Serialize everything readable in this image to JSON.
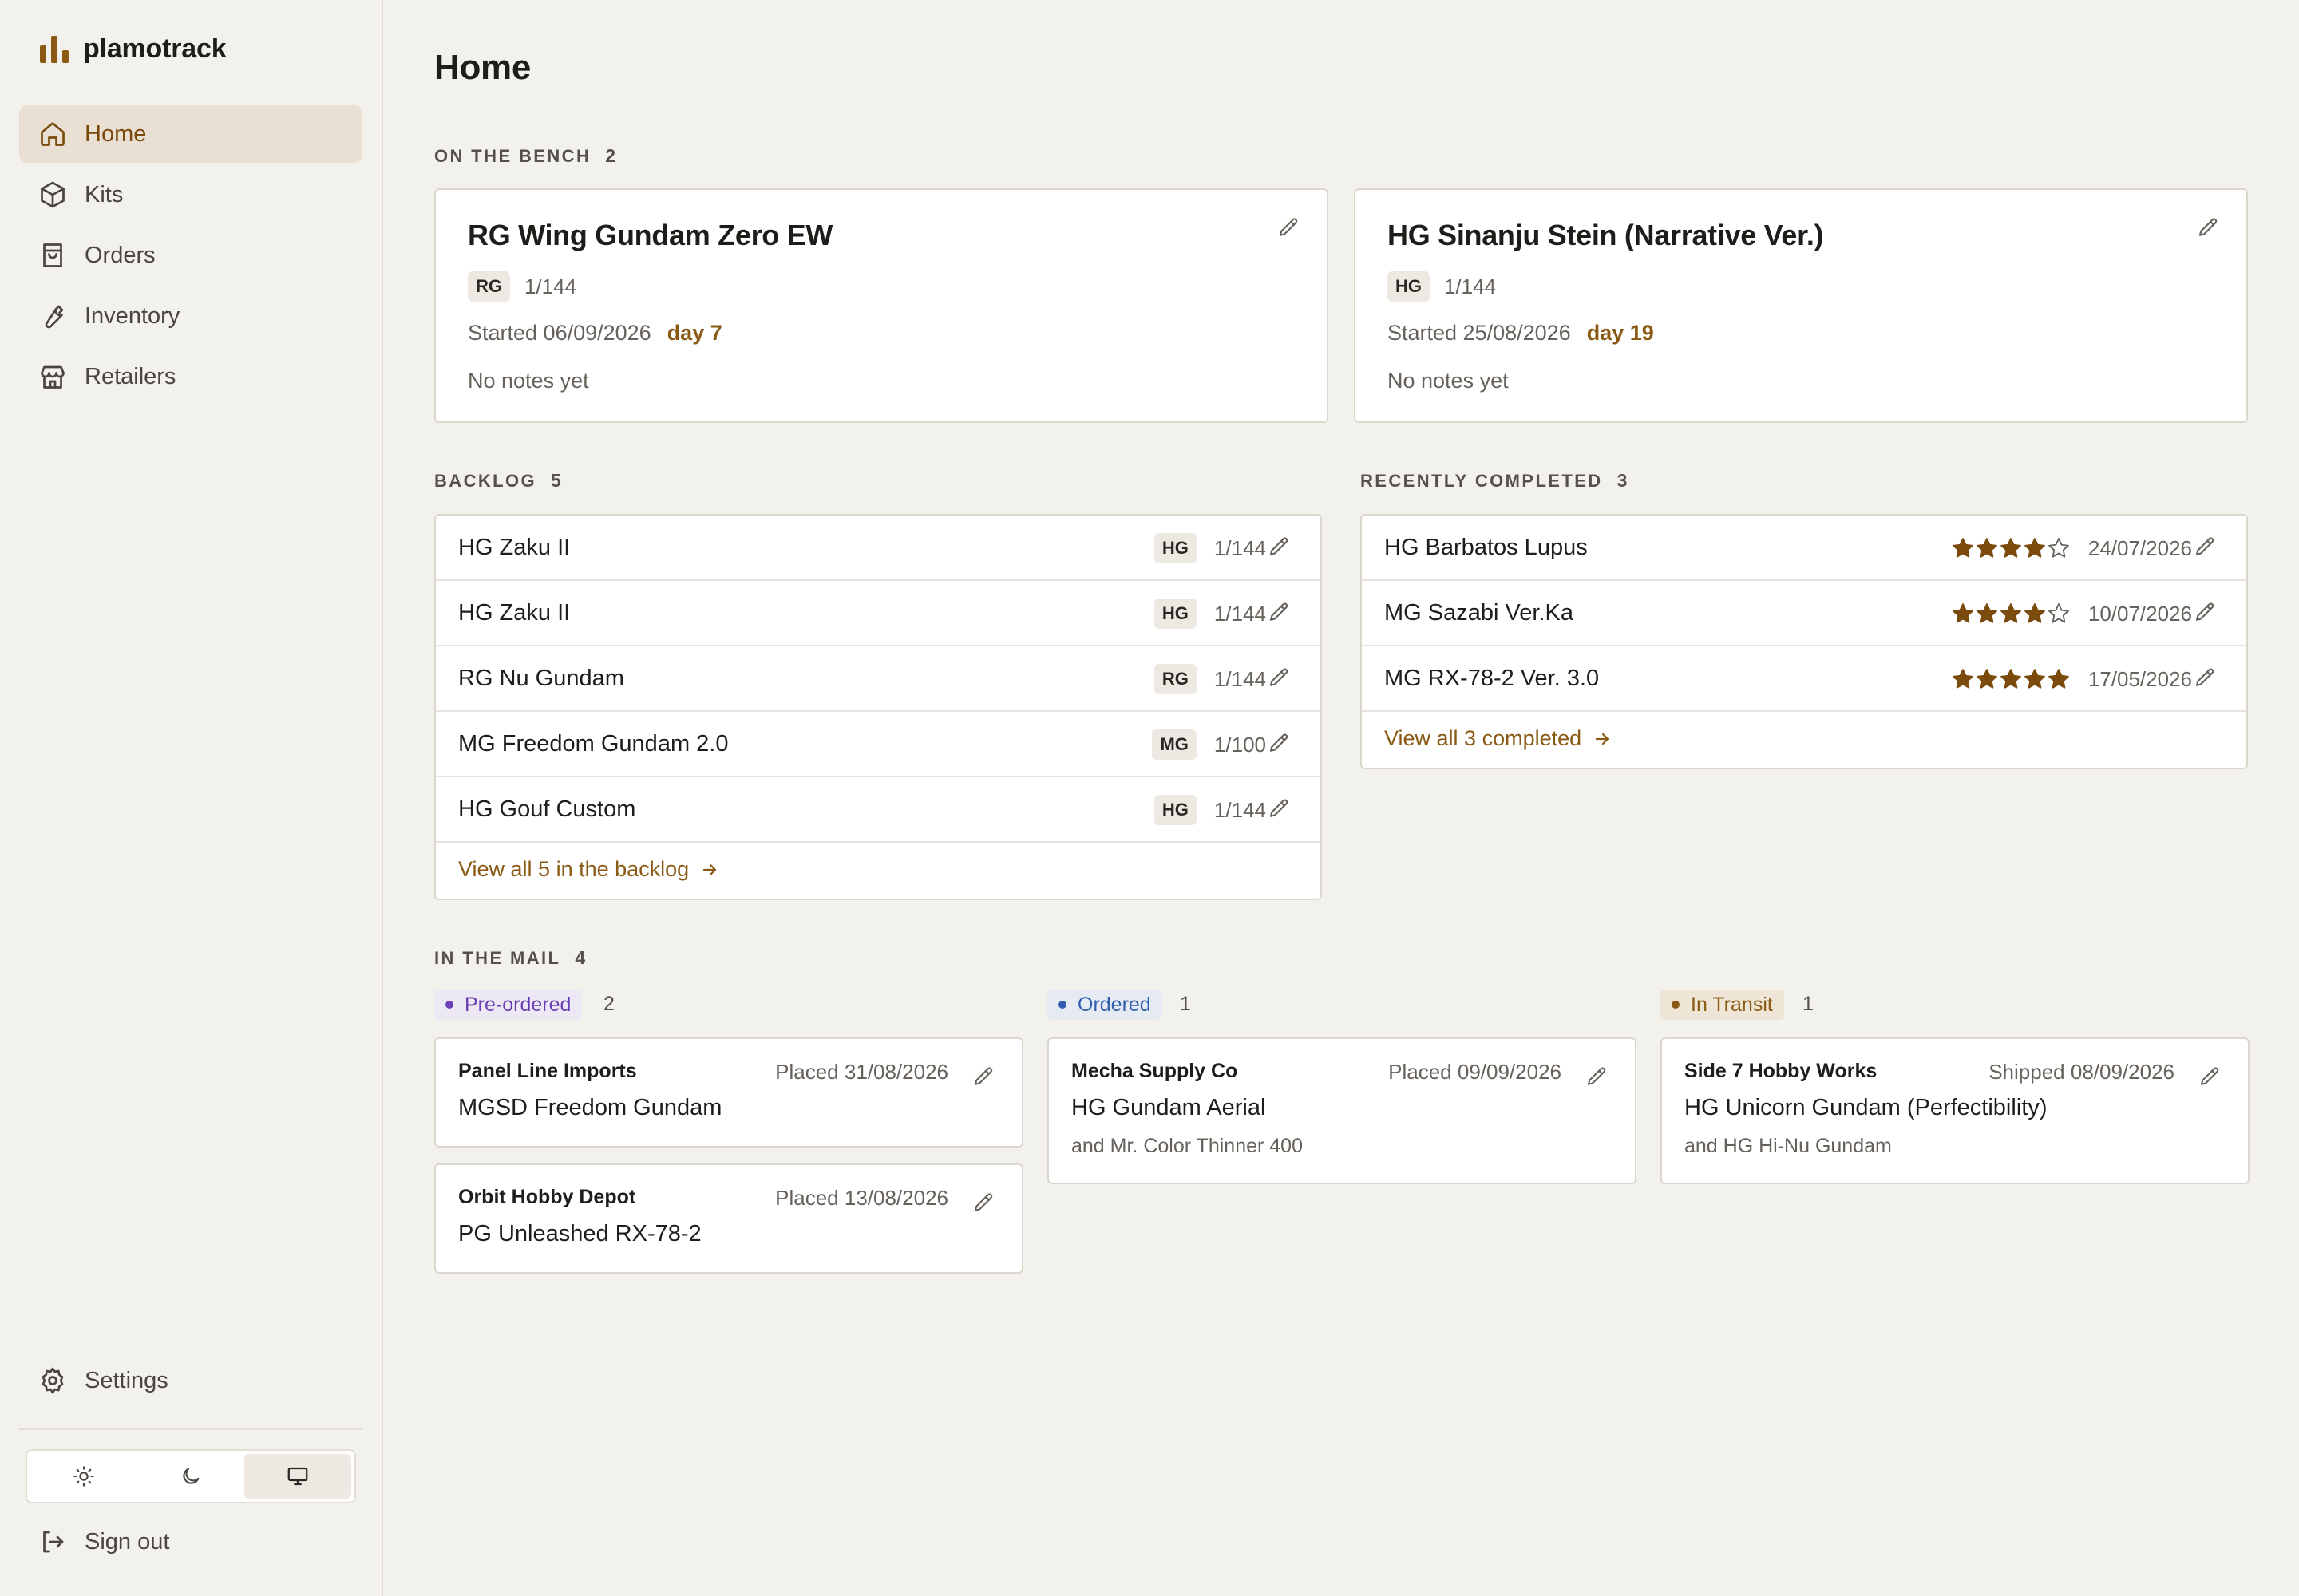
{
  "app": {
    "name": "plamotrack"
  },
  "sidebar": {
    "items": [
      {
        "label": "Home",
        "icon": "home-icon",
        "active": true
      },
      {
        "label": "Kits",
        "icon": "box-icon"
      },
      {
        "label": "Orders",
        "icon": "shopping-bag-icon"
      },
      {
        "label": "Inventory",
        "icon": "wrench-icon"
      },
      {
        "label": "Retailers",
        "icon": "store-icon"
      }
    ],
    "settings_label": "Settings",
    "signout_label": "Sign out",
    "theme_options": [
      "sun-icon",
      "moon-icon",
      "monitor-icon"
    ],
    "theme_selected": "monitor-icon"
  },
  "page": {
    "title": "Home"
  },
  "bench": {
    "label": "On the bench",
    "count": "2",
    "cards": [
      {
        "title": "RG Wing Gundam Zero EW",
        "grade": "RG",
        "scale": "1/144",
        "started": "Started 06/09/2026",
        "day": "day 7",
        "notes": "No notes yet"
      },
      {
        "title": "HG Sinanju Stein (Narrative Ver.)",
        "grade": "HG",
        "scale": "1/144",
        "started": "Started 25/08/2026",
        "day": "day 19",
        "notes": "No notes yet"
      }
    ]
  },
  "backlog": {
    "label": "Backlog",
    "count": "5",
    "rows": [
      {
        "name": "HG Zaku II",
        "grade": "HG",
        "scale": "1/144"
      },
      {
        "name": "HG Zaku II",
        "grade": "HG",
        "scale": "1/144"
      },
      {
        "name": "RG Nu Gundam",
        "grade": "RG",
        "scale": "1/144"
      },
      {
        "name": "MG Freedom Gundam 2.0",
        "grade": "MG",
        "scale": "1/100"
      },
      {
        "name": "HG Gouf Custom",
        "grade": "HG",
        "scale": "1/144"
      }
    ],
    "view_all": "View all 5 in the backlog"
  },
  "completed": {
    "label": "Recently completed",
    "count": "3",
    "rows": [
      {
        "name": "HG Barbatos Lupus",
        "rating": 4,
        "date": "24/07/2026"
      },
      {
        "name": "MG Sazabi Ver.Ka",
        "rating": 4,
        "date": "10/07/2026"
      },
      {
        "name": "MG RX-78-2 Ver. 3.0",
        "rating": 5,
        "date": "17/05/2026"
      }
    ],
    "view_all": "View all 3 completed"
  },
  "mail": {
    "label": "In the mail",
    "count": "4",
    "columns": [
      {
        "status": "Pre-ordered",
        "count": "2",
        "chip_bg": "#ece8f4",
        "chip_fg": "#6a3fb5",
        "orders": [
          {
            "retailer": "Panel Line Imports",
            "date": "Placed 31/08/2026",
            "item": "MGSD Freedom Gundam",
            "extra": ""
          },
          {
            "retailer": "Orbit Hobby Depot",
            "date": "Placed 13/08/2026",
            "item": "PG Unleashed RX-78-2",
            "extra": ""
          }
        ]
      },
      {
        "status": "Ordered",
        "count": "1",
        "chip_bg": "#e6ebf3",
        "chip_fg": "#2f5fae",
        "orders": [
          {
            "retailer": "Mecha Supply Co",
            "date": "Placed 09/09/2026",
            "item": "HG Gundam Aerial",
            "extra": "and Mr. Color Thinner 400"
          }
        ]
      },
      {
        "status": "In Transit",
        "count": "1",
        "chip_bg": "#efe5d6",
        "chip_fg": "#8a5a14",
        "orders": [
          {
            "retailer": "Side 7 Hobby Works",
            "date": "Shipped 08/09/2026",
            "item": "HG Unicorn Gundam (Perfectibility)",
            "extra": "and HG Hi-Nu Gundam"
          }
        ]
      }
    ]
  },
  "colors": {
    "accent": "#8a5a14",
    "accent_text": "#7a4b0c",
    "active_bg": "#e9e0d3",
    "background": "#f3f1ec",
    "card": "#ffffff",
    "border": "#dcd7ce",
    "star": "#7a4b0c"
  }
}
